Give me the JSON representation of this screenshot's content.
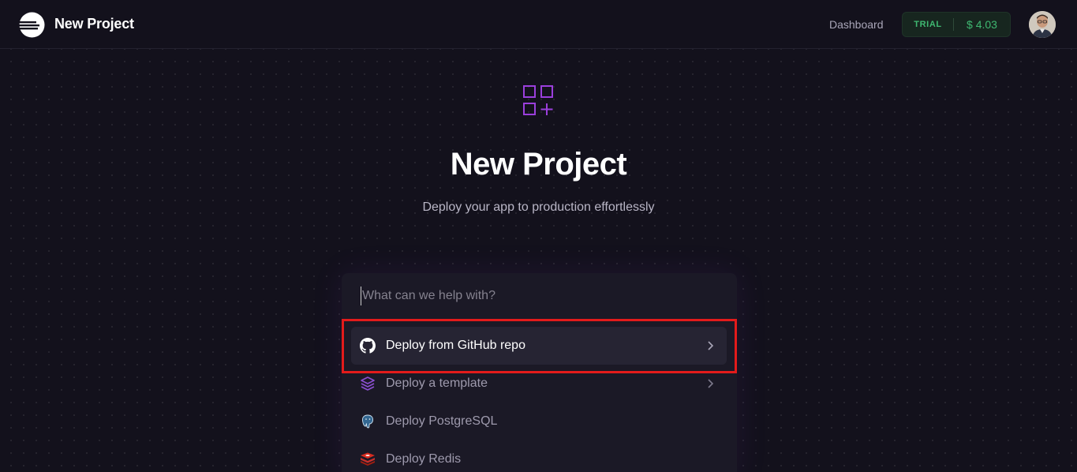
{
  "topbar": {
    "title": "New Project",
    "dashboard_label": "Dashboard",
    "plan_label": "TRIAL",
    "credit_label": "$ 4.03"
  },
  "hero": {
    "title": "New Project",
    "subtitle": "Deploy your app to production effortlessly"
  },
  "palette": {
    "search_placeholder": "What can we help with?",
    "options": [
      {
        "label": "Deploy from GitHub repo",
        "icon": "github-icon",
        "has_chevron": true,
        "active": true
      },
      {
        "label": "Deploy a template",
        "icon": "layers-icon",
        "has_chevron": true,
        "active": false
      },
      {
        "label": "Deploy PostgreSQL",
        "icon": "postgresql-icon",
        "has_chevron": false,
        "active": false
      },
      {
        "label": "Deploy Redis",
        "icon": "redis-icon",
        "has_chevron": false,
        "active": false
      }
    ]
  },
  "colors": {
    "background": "#13111c",
    "accent_purple": "#9b3fdc",
    "trial_green": "#3fb871",
    "highlight_red": "#e31b1b"
  }
}
